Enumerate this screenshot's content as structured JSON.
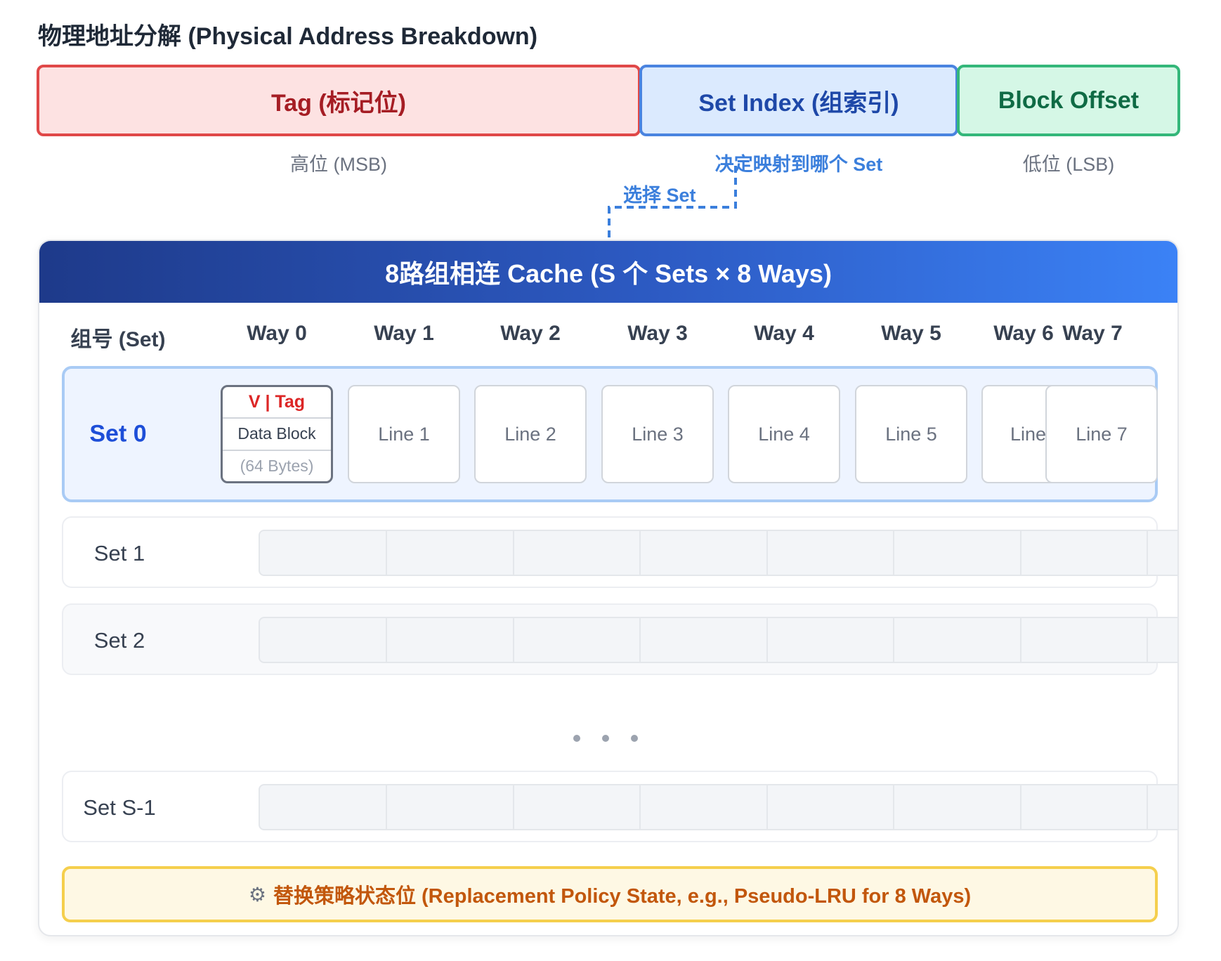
{
  "title": "物理地址分解 (Physical Address Breakdown)",
  "address": {
    "tag": "Tag (标记位)",
    "set_index": "Set Index (组索引)",
    "block_offset": "Block Offset",
    "msb_note": "高位 (MSB)",
    "set_note": "决定映射到哪个 Set",
    "lsb_note": "低位 (LSB)",
    "select_label": "选择 Set"
  },
  "cache": {
    "header": "8路组相连 Cache (S 个 Sets × 8 Ways)",
    "set_column_header": "组号 (Set)",
    "ways": [
      "Way 0",
      "Way 1",
      "Way 2",
      "Way 3",
      "Way 4",
      "Way 5",
      "Way 6",
      "Way 7"
    ],
    "set0": {
      "label": "Set 0",
      "way0": {
        "tag": "V | Tag",
        "data": "Data Block",
        "size": "(64 Bytes)"
      },
      "lines": [
        "Line 1",
        "Line 2",
        "Line 3",
        "Line 4",
        "Line 5",
        "Line",
        "Line 7"
      ]
    },
    "set1_label": "Set 1",
    "set2_label": "Set 2",
    "set_last_label": "Set S-1",
    "policy": "替换策略状态位 (Replacement Policy State, e.g., Pseudo-LRU for 8 Ways)",
    "policy_icon": "gear-icon"
  },
  "colors": {
    "tag_border": "#e04848",
    "set_border": "#4a84e0",
    "offset_border": "#34b77a",
    "header_start": "#1e3a8a",
    "header_end": "#3b82f6",
    "policy_border": "#f5cf4d"
  }
}
